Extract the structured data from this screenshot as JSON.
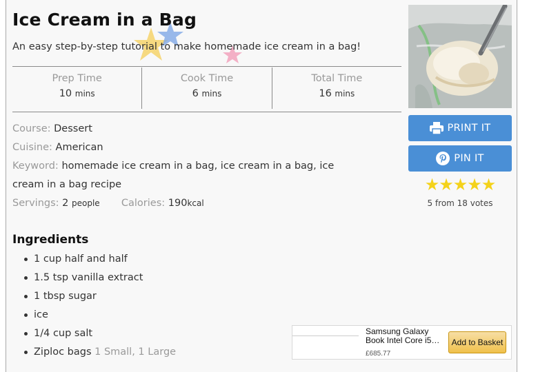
{
  "recipe": {
    "title": "Ice Cream in a Bag",
    "summary": "An easy step-by-step tutorial to make homemade ice cream in a bag!",
    "times": [
      {
        "label": "Prep Time",
        "value": "10",
        "unit": "mins"
      },
      {
        "label": "Cook Time",
        "value": "6",
        "unit": "mins"
      },
      {
        "label": "Total Time",
        "value": "16",
        "unit": "mins"
      }
    ],
    "course": {
      "label": "Course:",
      "value": "Dessert"
    },
    "cuisine": {
      "label": "Cuisine:",
      "value": "American"
    },
    "keyword": {
      "label": "Keyword:",
      "value_line1": "homemade ice cream in a bag, ice cream in a bag, ice",
      "value_line2": "cream in a bag recipe"
    },
    "servings": {
      "label": "Servings:",
      "value": "2",
      "unit": "people"
    },
    "calories": {
      "label": "Calories:",
      "value": "190",
      "unit": "kcal"
    }
  },
  "actions": {
    "print_label": "PRINT IT",
    "pin_label": "PIN IT"
  },
  "rating": {
    "stars": "★★★★★",
    "text": "5 from 18 votes",
    "value": 5,
    "votes": 18
  },
  "ingredients": {
    "heading": "Ingredients",
    "items": [
      {
        "text": "1 cup half and half",
        "note": ""
      },
      {
        "text": "1.5 tsp vanilla extract",
        "note": ""
      },
      {
        "text": "1 tbsp sugar",
        "note": ""
      },
      {
        "text": "ice",
        "note": ""
      },
      {
        "text": "1/4 cup salt",
        "note": ""
      },
      {
        "text": "Ziploc bags",
        "note": "1 Small, 1 Large"
      }
    ]
  },
  "ad": {
    "title": "Samsung Galaxy Book Intel Core i5…",
    "price": "£685.77",
    "button": "Add to Basket"
  },
  "colors": {
    "button_blue": "#4a8fd6",
    "star_yellow": "#f4d21a",
    "muted_label": "#999999"
  }
}
